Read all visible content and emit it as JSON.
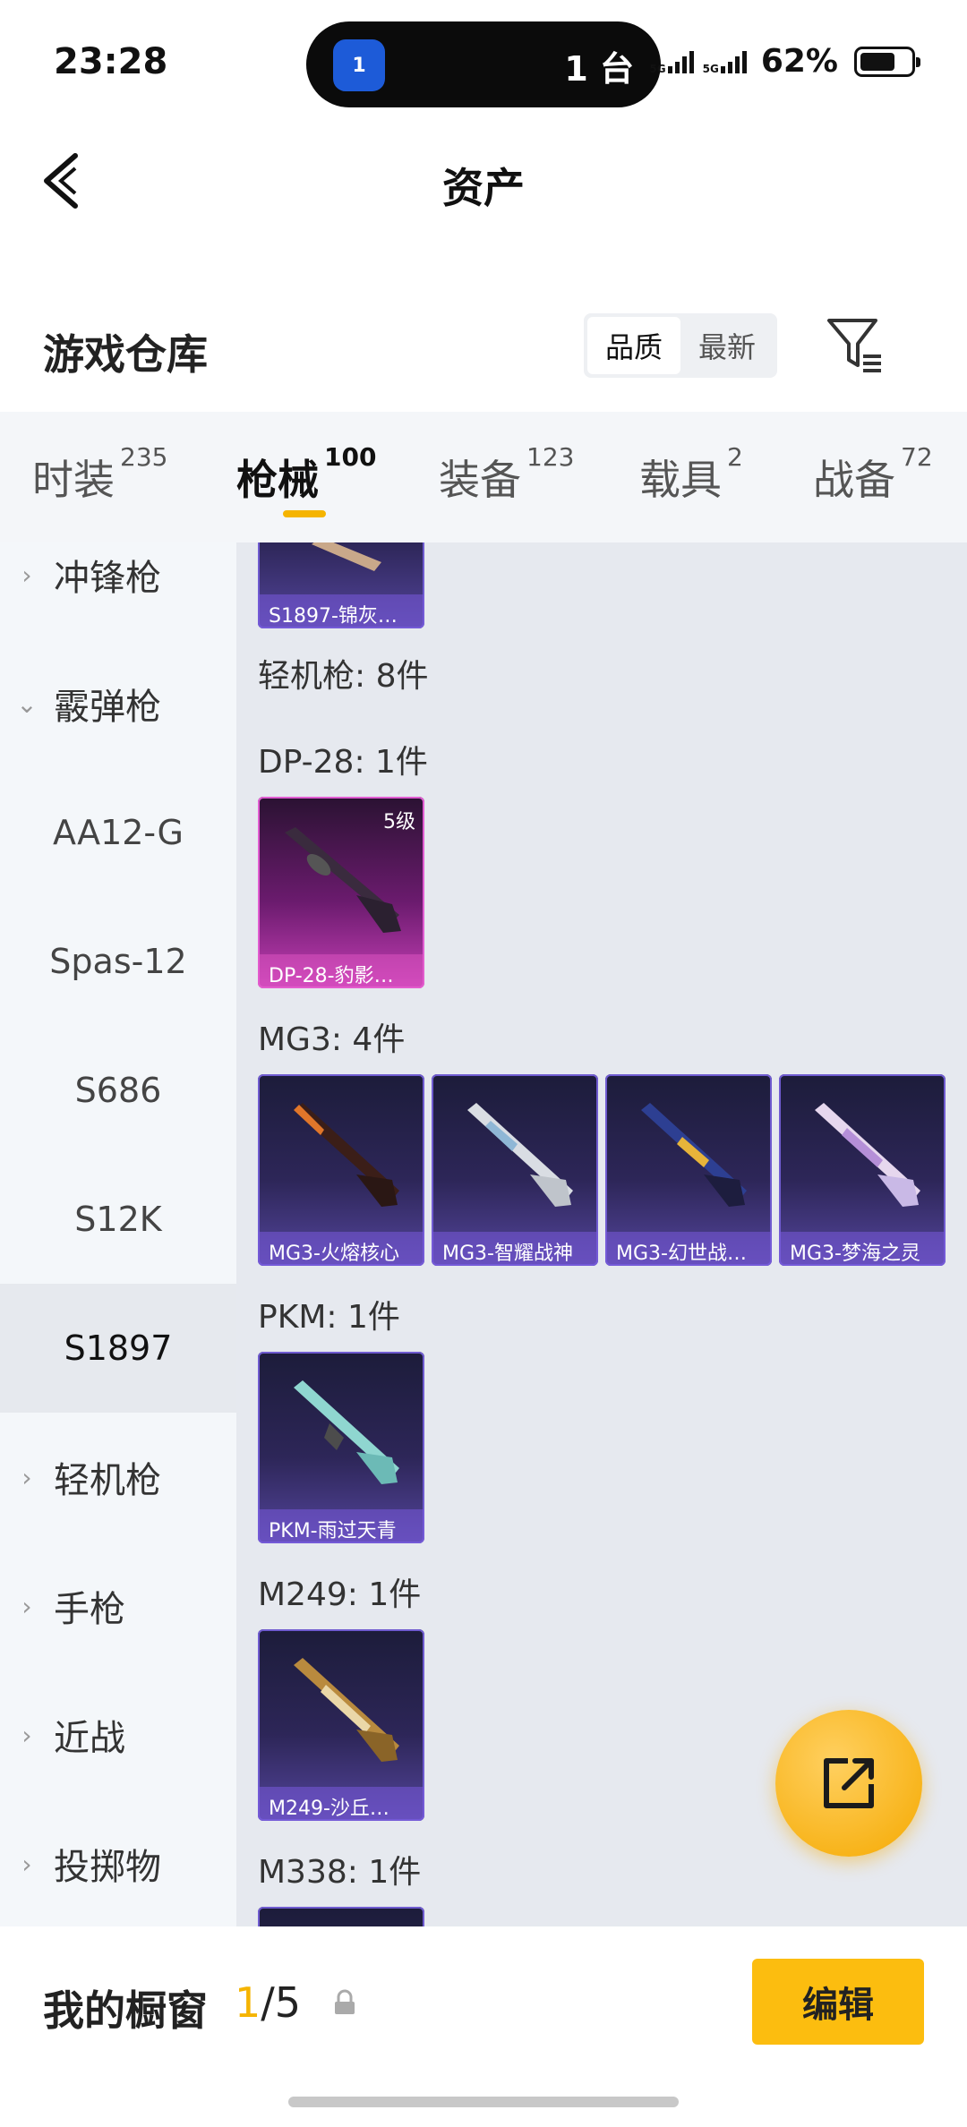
{
  "status_bar": {
    "time": "23:28",
    "island_app_badge": "1",
    "island_text": "1 台",
    "network_1": "5G",
    "network_2": "5G",
    "battery_percent": "62%"
  },
  "nav": {
    "title": "资产"
  },
  "warehouse": {
    "title": "游戏仓库",
    "sort_options": [
      "品质",
      "最新"
    ],
    "sort_selected": "品质"
  },
  "tabs": [
    {
      "label": "时装",
      "count": "235"
    },
    {
      "label": "枪械",
      "count": "100",
      "active": true
    },
    {
      "label": "装备",
      "count": "123"
    },
    {
      "label": "载具",
      "count": "2"
    },
    {
      "label": "战备",
      "count": "72"
    }
  ],
  "sidebar": {
    "items": [
      {
        "label": "冲锋枪"
      },
      {
        "label": "霰弹枪"
      },
      {
        "label": "AA12-G"
      },
      {
        "label": "Spas-12"
      },
      {
        "label": "S686"
      },
      {
        "label": "S12K"
      },
      {
        "label": "S1897",
        "active": true
      },
      {
        "label": "轻机枪"
      },
      {
        "label": "手枪"
      },
      {
        "label": "近战"
      },
      {
        "label": "投掷物"
      }
    ]
  },
  "content": {
    "top_partial_card": "S1897-锦灰…",
    "category_header": "轻机枪: 8件",
    "groups": [
      {
        "header": "DP-28: 1件",
        "cards": [
          {
            "name": "DP-28-豹影…",
            "level": "5级",
            "rarity": "pink"
          }
        ]
      },
      {
        "header": "MG3: 4件",
        "cards": [
          {
            "name": "MG3-火熔核心"
          },
          {
            "name": "MG3-智耀战神"
          },
          {
            "name": "MG3-幻世战…"
          },
          {
            "name": "MG3-梦海之灵"
          }
        ]
      },
      {
        "header": "PKM: 1件",
        "cards": [
          {
            "name": "PKM-雨过天青"
          }
        ]
      },
      {
        "header": "M249: 1件",
        "cards": [
          {
            "name": "M249-沙丘…"
          }
        ]
      },
      {
        "header": "M338: 1件",
        "cards": []
      }
    ],
    "colors": {
      "accent": "#f5b400",
      "card_purple": "#54459c",
      "card_pink": "#c63fb6"
    }
  },
  "bottom_bar": {
    "showcase_label": "我的橱窗",
    "showcase_current": "1",
    "showcase_total": "/5",
    "edit_label": "编辑"
  }
}
